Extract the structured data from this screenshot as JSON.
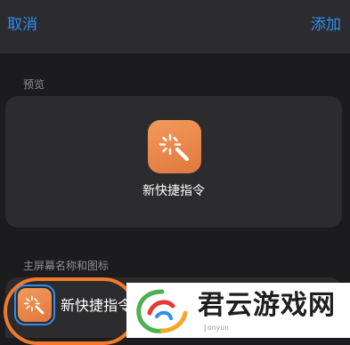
{
  "navbar": {
    "cancel_label": "取消",
    "add_label": "添加"
  },
  "preview_section": {
    "label": "预览",
    "shortcut_name": "新快捷指令",
    "icon": "magic-wand-icon",
    "icon_color": "#e8834a"
  },
  "home_section": {
    "label": "主屏幕名称和图标",
    "shortcut_name": "新快捷指令",
    "icon": "magic-wand-icon"
  },
  "watermark": {
    "text": "君云游戏网",
    "sub": "jonyun"
  },
  "colors": {
    "accent": "#2f8df2",
    "background": "#1c1c1e",
    "card": "#2c2c2e",
    "highlight": "#f07a2a"
  }
}
